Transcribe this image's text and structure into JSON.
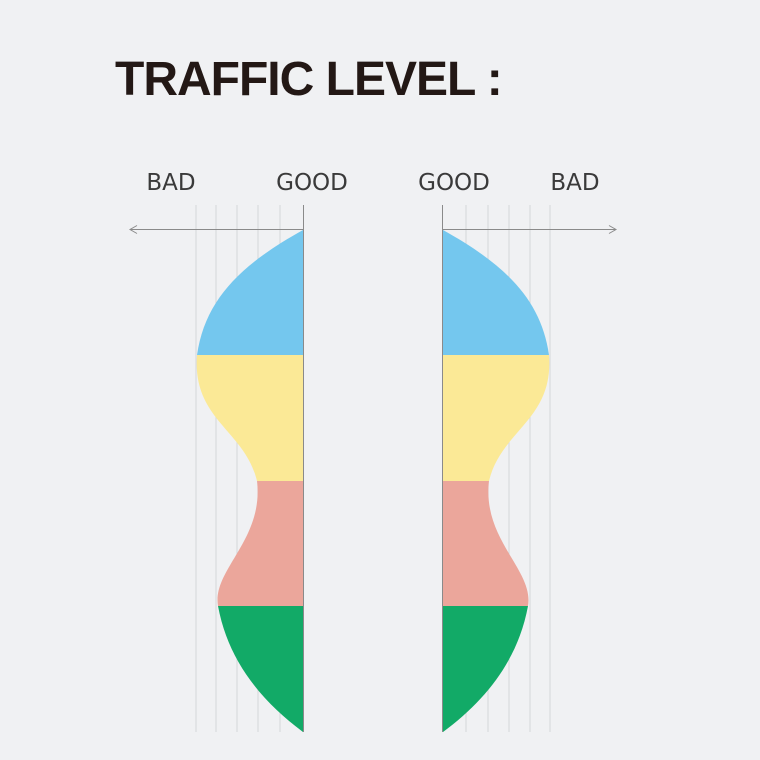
{
  "title": "TRAFFIC LEVEL :",
  "left_panel": {
    "bad_label": "BAD",
    "good_label": "GOOD"
  },
  "right_panel": {
    "good_label": "GOOD",
    "bad_label": "BAD"
  },
  "colors": {
    "background": "#f0f1f3",
    "band_blue": "#74c7ee",
    "band_yellow": "#fbe996",
    "band_pink": "#eba69b",
    "band_green": "#12aa67",
    "axis": "#8a8a8a",
    "gridline": "#d4d6d9"
  }
}
